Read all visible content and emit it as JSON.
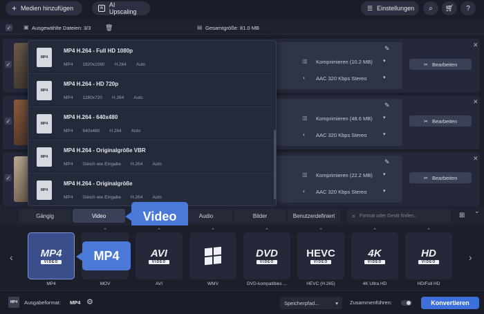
{
  "toolbar": {
    "add_media_label": "Medien hinzufügen",
    "ai_upscaling_label": "AI Upscaling",
    "settings_label": "Einstellungen"
  },
  "subbar": {
    "selected_files_label": "Ausgewählte Dateien: 3/3",
    "total_size_label": "Gesamtgröße: 81.0 MB"
  },
  "files": [
    {
      "compress_label": "Komprimieren (10.2 MB)",
      "audio_label": "AAC 320 Kbps Stereo",
      "edit_label": "Bearbeiten"
    },
    {
      "compress_label": "Komprimieren (48.6 MB)",
      "audio_label": "AAC 320 Kbps Stereo",
      "edit_label": "Bearbeiten"
    },
    {
      "compress_label": "Komprimieren (22.2 MB)",
      "audio_label": "AAC 320 Kbps Stereo",
      "edit_label": "Bearbeiten"
    }
  ],
  "dropdown": {
    "items": [
      {
        "title": "MP4 H.264 - Full HD 1080p",
        "meta": [
          "MP4",
          "1920x1080",
          "H.264",
          "Auto"
        ],
        "doc": "MP4"
      },
      {
        "title": "MP4 H.264 - HD 720p",
        "meta": [
          "MP4",
          "1280x720",
          "H.264",
          "Auto"
        ],
        "doc": "MP4"
      },
      {
        "title": "MP4 H.264 - 640x480",
        "meta": [
          "MP4",
          "640x480",
          "H.264",
          "Auto"
        ],
        "doc": "MP4"
      },
      {
        "title": "MP4 H.264 - Originalgröße VBR",
        "meta": [
          "MP4",
          "Gleich wie Eingabe",
          "H.264",
          "Auto"
        ],
        "doc": "MP4"
      },
      {
        "title": "MP4 H.264 - Originalgröße",
        "meta": [
          "MP4",
          "Gleich wie Eingabe",
          "H.264",
          "Auto"
        ],
        "doc": "MP4"
      }
    ]
  },
  "tabs": [
    {
      "label": "Gängig"
    },
    {
      "label": "Video",
      "active": true
    },
    {
      "label": "Audio"
    },
    {
      "label": "Bilder"
    },
    {
      "label": "Benutzerdefiniert"
    }
  ],
  "search": {
    "placeholder": "Format oder Gerät finden..."
  },
  "callouts": {
    "video": "Video",
    "mp4": "MP4"
  },
  "formats": [
    {
      "big": "MP4",
      "sub": "VIDEO",
      "label": "MP4",
      "selected": true
    },
    {
      "big": "",
      "sub": "",
      "label": "MOV"
    },
    {
      "big": "AVI",
      "sub": "VIDEO",
      "label": "AVI"
    },
    {
      "big": "",
      "sub": "",
      "label": "WMV"
    },
    {
      "big": "DVD",
      "sub": "VIDEO",
      "label": "DVD-kompatibles ..."
    },
    {
      "big": "HEVC",
      "sub": "VIDEO",
      "label": "HEVC (H.265)"
    },
    {
      "big": "4K",
      "sub": "VIDEO",
      "label": "4K Ultra HD"
    },
    {
      "big": "HD",
      "sub": "VIDEO",
      "label": "HD/Full HD"
    }
  ],
  "footer": {
    "output_format_label": "Ausgabeformat:",
    "output_format_value": "MP4",
    "save_path_label": "Speicherpfad...",
    "merge_label": "Zusammenführen:",
    "convert_label": "Konvertieren"
  },
  "colors": {
    "accent": "#3d6fdb",
    "callout": "#4a79d8",
    "background": "#1c1f2a"
  }
}
